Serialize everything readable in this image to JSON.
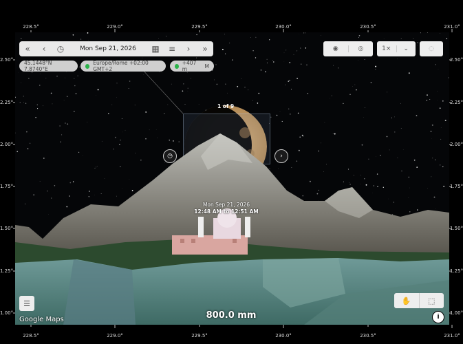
{
  "axis": {
    "top_ticks": [
      "228.5°",
      "229.0°",
      "229.5°",
      "230.0°",
      "230.5°",
      "231.0°"
    ],
    "bottom_ticks": [
      "228.5°",
      "229.0°",
      "229.5°",
      "230.0°",
      "230.5°",
      "231.0°"
    ],
    "left_ticks": [
      "2.50°",
      "2.25°",
      "2.00°",
      "1.75°",
      "1.50°",
      "1.25°",
      "1.00°"
    ],
    "right_ticks": [
      "2.50°",
      "2.25°",
      "2.00°",
      "1.75°",
      "1.50°",
      "1.25°",
      "1.00°"
    ]
  },
  "toolbar": {
    "first_icon": "double-chevron-left-icon",
    "prev_icon": "chevron-left-icon",
    "clock_icon": "clock-icon",
    "date": "Mon Sep 21, 2026",
    "calendar_icon": "calendar-icon",
    "menu_icon": "menu-icon",
    "next_icon": "chevron-right-icon",
    "last_icon": "double-chevron-right-icon"
  },
  "pills": {
    "coords": "45.1448°N 7.8740°E",
    "timezone": "Europe/Rome +02:00 GMT+2",
    "elevation": "+407 m",
    "elevation_unit": "M"
  },
  "top_right": {
    "zoom_label": "1×"
  },
  "view": {
    "counter": "1 of 9",
    "event_date": "Mon Sep 21, 2026",
    "event_time": "12:48 AM to 12:51 AM"
  },
  "bottom": {
    "attribution": "Google Maps",
    "focal_length": "800.0 mm",
    "info_label": "i"
  },
  "colors": {
    "sky": "#050608",
    "moon_lit": "#c9a36e",
    "mountain": "#8e8e88",
    "pill_bg": "#cfcfcf",
    "status_green": "#2bb34a"
  }
}
